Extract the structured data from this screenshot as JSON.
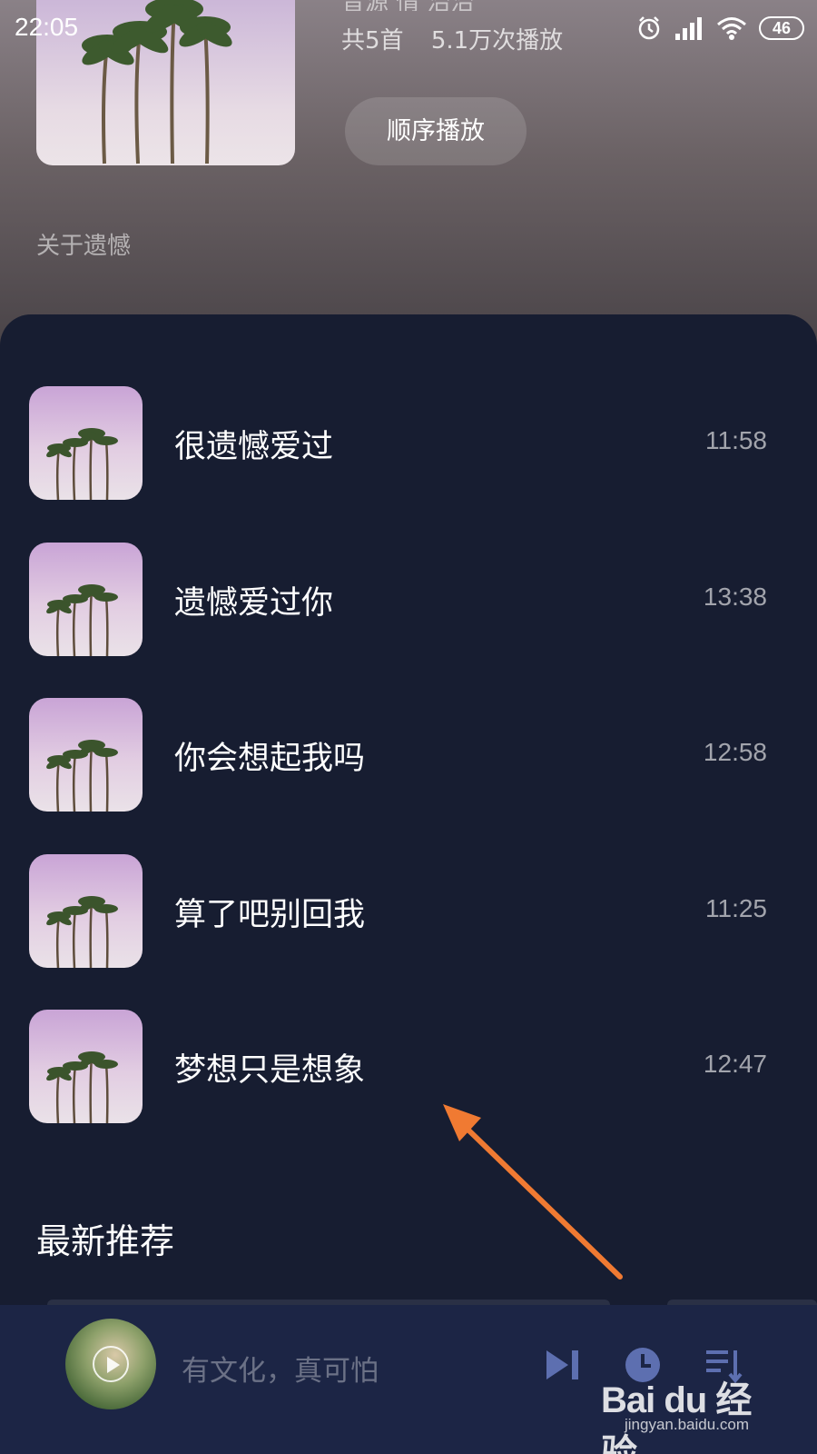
{
  "status_bar": {
    "time": "22:05",
    "battery": "46"
  },
  "header": {
    "partial_info": "音源  情  治治",
    "song_count": "共5首",
    "play_count": "5.1万次播放",
    "order_button": "顺序播放",
    "description": "关于遗憾"
  },
  "songs": [
    {
      "title": "很遗憾爱过",
      "duration": "11:58"
    },
    {
      "title": "遗憾爱过你",
      "duration": "13:38"
    },
    {
      "title": "你会想起我吗",
      "duration": "12:58"
    },
    {
      "title": "算了吧别回我",
      "duration": "11:25"
    },
    {
      "title": "梦想只是想象",
      "duration": "12:47"
    }
  ],
  "section": {
    "title": "最新推荐"
  },
  "player": {
    "now_playing": "有文化，真可怕"
  },
  "watermark": {
    "logo": "Bai du 经验",
    "url": "jingyan.baidu.com"
  },
  "colors": {
    "panel_bg": "#171d31",
    "player_bg": "#1c2545",
    "icon_accent": "#5d6fb0",
    "annotation_arrow": "#f07a32"
  }
}
